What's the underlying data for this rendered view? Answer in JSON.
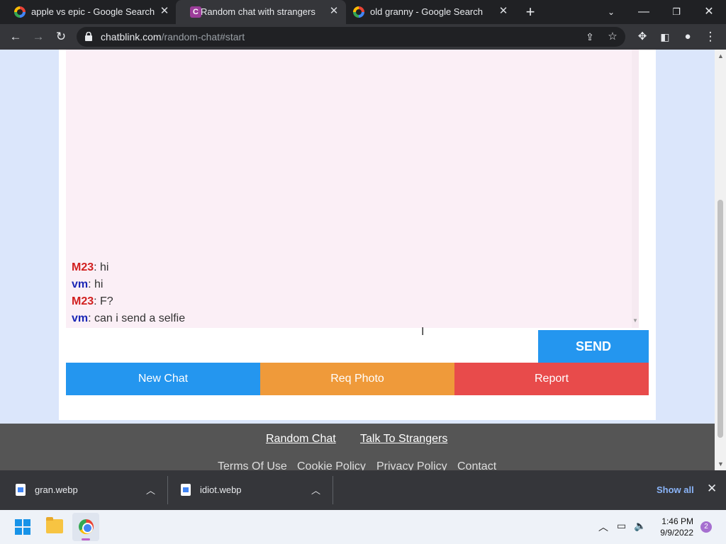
{
  "browser": {
    "tabs": [
      {
        "title": "apple vs epic - Google Search",
        "favicon": "google-icon",
        "active": false
      },
      {
        "title": "Random chat with strangers",
        "favicon": "chatblink-icon",
        "active": true
      },
      {
        "title": "old granny - Google Search",
        "favicon": "google-icon",
        "active": false
      }
    ],
    "new_tab": "+",
    "address": {
      "domain": "chatblink.com",
      "path": "/random-chat#start"
    }
  },
  "chat": {
    "messages": [
      {
        "sender": "M23",
        "text": ": hi",
        "color": "#d11f1f"
      },
      {
        "sender": "vm",
        "text": ": hi",
        "color": "#1b27b5"
      },
      {
        "sender": "M23",
        "text": ": F?",
        "color": "#d11f1f"
      },
      {
        "sender": "vm",
        "text": ": can i send a selfie",
        "color": "#1b27b5"
      }
    ],
    "input_value": "",
    "send_label": "SEND",
    "actions": [
      {
        "label": "New Chat",
        "color": "#2496ef"
      },
      {
        "label": "Req Photo",
        "color": "#ef9a3a"
      },
      {
        "label": "Report",
        "color": "#e84b4b"
      }
    ]
  },
  "footer": {
    "links_primary": [
      "Random Chat",
      "Talk To Strangers"
    ],
    "links_secondary": [
      "Terms Of Use",
      "Cookie Policy",
      "Privacy Policy",
      "Contact"
    ]
  },
  "downloads": {
    "items": [
      {
        "name": "gran.webp"
      },
      {
        "name": "idiot.webp"
      }
    ],
    "show_all": "Show all"
  },
  "taskbar": {
    "time": "1:46 PM",
    "date": "9/9/2022",
    "notifications": "2"
  }
}
